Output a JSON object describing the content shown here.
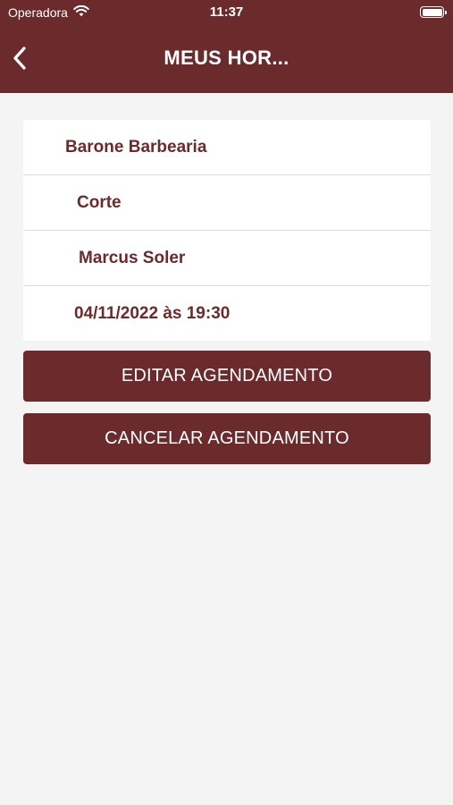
{
  "status_bar": {
    "carrier": "Operadora",
    "time": "11:37"
  },
  "header": {
    "title": "MEUS HOR...",
    "back_icon": "chevron-left-icon"
  },
  "appointment": {
    "barbershop": "Barone Barbearia",
    "service": "Corte",
    "barber": "Marcus Soler",
    "datetime": "04/11/2022 às 19:30"
  },
  "actions": {
    "edit_label": "EDITAR AGENDAMENTO",
    "cancel_label": "CANCELAR AGENDAMENTO"
  },
  "colors": {
    "brand": "#6b2a2c",
    "background": "#f4f4f4",
    "card": "#ffffff"
  }
}
